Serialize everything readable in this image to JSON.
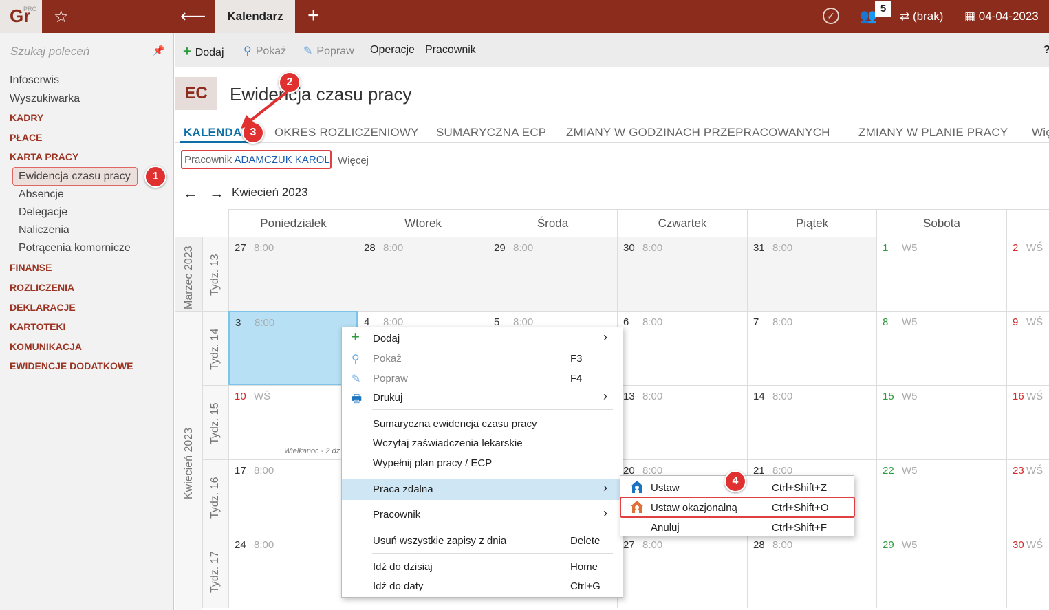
{
  "topbar": {
    "logo_text": "Gr",
    "logo_badge": "PRO",
    "active_tab": "Kalendarz",
    "notification_count": "5",
    "user_label": "(brak)",
    "date": "04-04-2023"
  },
  "sidebar": {
    "search_placeholder": "Szukaj poleceń",
    "items": [
      {
        "label": "Infoserwis",
        "type": "g"
      },
      {
        "label": "Wyszukiwarka",
        "type": "g"
      },
      {
        "label": "KADRY",
        "type": "s"
      },
      {
        "label": "PŁACE",
        "type": "s"
      },
      {
        "label": "KARTA PRACY",
        "type": "s"
      },
      {
        "label": "Ewidencja czasu pracy",
        "type": "sub"
      },
      {
        "label": "Absencje",
        "type": "sub"
      },
      {
        "label": "Delegacje",
        "type": "sub"
      },
      {
        "label": "Naliczenia",
        "type": "sub"
      },
      {
        "label": "Potrącenia komornicze",
        "type": "sub"
      },
      {
        "label": "FINANSE",
        "type": "s"
      },
      {
        "label": "ROZLICZENIA",
        "type": "s"
      },
      {
        "label": "DEKLARACJE",
        "type": "s"
      },
      {
        "label": "KARTOTEKI",
        "type": "s"
      },
      {
        "label": "KOMUNIKACJA",
        "type": "s"
      },
      {
        "label": "EWIDENCJE DODATKOWE",
        "type": "s"
      }
    ]
  },
  "toolbar": {
    "add": "Dodaj",
    "show": "Pokaż",
    "edit": "Popraw",
    "operations": "Operacje",
    "employee": "Pracownik",
    "help": "?"
  },
  "header": {
    "code": "EC",
    "title": "Ewidencja czasu pracy"
  },
  "tabs": [
    "KALENDARZ",
    "OKRES ROZLICZENIOWY",
    "SUMARYCZNA ECP",
    "ZMIANY W GODZINACH PRZEPRACOWANYCH",
    "ZMIANY W PLANIE PRACY",
    "Więc"
  ],
  "filter": {
    "employee_label": "Pracownik",
    "employee_value": "ADAMCZUK KAROL",
    "more": "Więcej"
  },
  "calendar": {
    "month": "Kwiecień 2023",
    "days": [
      "Poniedziałek",
      "Wtorek",
      "Środa",
      "Czwartek",
      "Piątek",
      "Sobota"
    ],
    "months": [
      "Marzec 2023",
      "Kwiecień 2023"
    ],
    "weeks": [
      {
        "label": "Tydz. 13",
        "cells": [
          [
            "27",
            "8:00"
          ],
          [
            "28",
            "8:00"
          ],
          [
            "29",
            "8:00"
          ],
          [
            "30",
            "8:00"
          ],
          [
            "31",
            "8:00"
          ],
          [
            "1",
            "W5"
          ],
          [
            "2",
            "WŚ"
          ]
        ]
      },
      {
        "label": "Tydz. 14",
        "cells": [
          [
            "3",
            "8:00"
          ],
          [
            "4",
            "8:00"
          ],
          [
            "5",
            "8:00"
          ],
          [
            "6",
            "8:00"
          ],
          [
            "7",
            "8:00"
          ],
          [
            "8",
            "W5"
          ],
          [
            "9",
            "WŚ"
          ]
        ]
      },
      {
        "label": "Tydz. 15",
        "cells": [
          [
            "10",
            "WŚ"
          ],
          [
            "",
            ""
          ],
          [
            "",
            ""
          ],
          [
            "13",
            "8:00"
          ],
          [
            "14",
            "8:00"
          ],
          [
            "15",
            "W5"
          ],
          [
            "16",
            "WŚ"
          ]
        ]
      },
      {
        "label": "Tydz. 16",
        "cells": [
          [
            "17",
            "8:00"
          ],
          [
            "",
            ""
          ],
          [
            "",
            ""
          ],
          [
            "20",
            "8:00"
          ],
          [
            "21",
            "8:00"
          ],
          [
            "22",
            "W5"
          ],
          [
            "23",
            "WŚ"
          ]
        ]
      },
      {
        "label": "Tydz. 17",
        "cells": [
          [
            "24",
            "8:00"
          ],
          [
            "",
            ""
          ],
          [
            "",
            ""
          ],
          [
            "27",
            "8:00"
          ],
          [
            "28",
            "8:00"
          ],
          [
            "29",
            "W5"
          ],
          [
            "30",
            "WŚ"
          ]
        ]
      }
    ],
    "holiday_note": "Wielkanoc - 2 dz"
  },
  "context_menu": {
    "items": [
      {
        "label": "Dodaj",
        "key": "",
        "arrow": "›"
      },
      {
        "label": "Pokaż",
        "key": "F3",
        "arrow": ""
      },
      {
        "label": "Popraw",
        "key": "F4",
        "arrow": ""
      },
      {
        "label": "Drukuj",
        "key": "",
        "arrow": "›"
      },
      {
        "label": "Sumaryczna ewidencja czasu pracy",
        "key": "",
        "arrow": ""
      },
      {
        "label": "Wczytaj zaświadczenia lekarskie",
        "key": "",
        "arrow": ""
      },
      {
        "label": "Wypełnij plan pracy / ECP",
        "key": "",
        "arrow": ""
      },
      {
        "label": "Praca zdalna",
        "key": "",
        "arrow": "›"
      },
      {
        "label": "Pracownik",
        "key": "",
        "arrow": "›"
      },
      {
        "label": "Usuń wszystkie zapisy z dnia",
        "key": "Delete",
        "arrow": ""
      },
      {
        "label": "Idź do dzisiaj",
        "key": "Home",
        "arrow": ""
      },
      {
        "label": "Idź do daty",
        "key": "Ctrl+G",
        "arrow": ""
      }
    ]
  },
  "submenu": {
    "items": [
      {
        "label": "Ustaw",
        "key": "Ctrl+Shift+Z"
      },
      {
        "label": "Ustaw okazjonalną",
        "key": "Ctrl+Shift+O"
      },
      {
        "label": "Anuluj",
        "key": "Ctrl+Shift+F"
      }
    ]
  },
  "markers": [
    "1",
    "2",
    "3",
    "4"
  ],
  "colors": {
    "brand": "#8c2c1c",
    "accent_blue": "#0e6fa6",
    "selected_cell": "#b7e0f4",
    "highlight_red": "#e04040",
    "weekend_green": "#2e9a3e",
    "sunday_red": "#d42a2a"
  }
}
